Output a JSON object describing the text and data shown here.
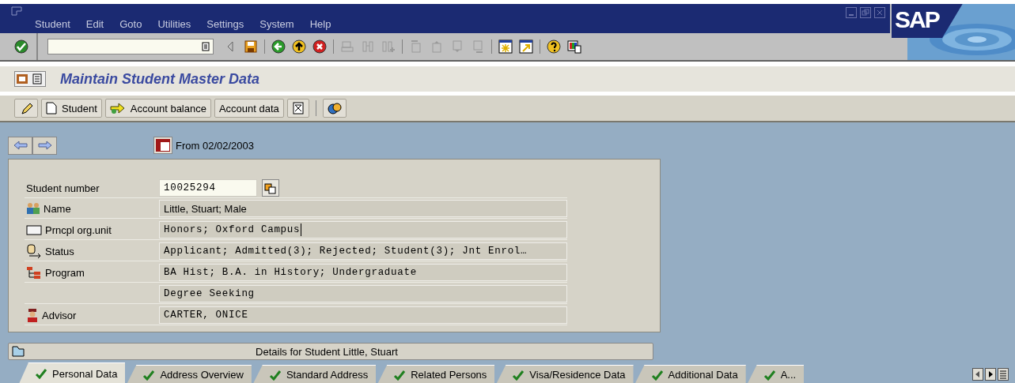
{
  "menu": [
    "Student",
    "Edit",
    "Goto",
    "Utilities",
    "Settings",
    "System",
    "Help"
  ],
  "logo": "SAP",
  "title": "Maintain Student Master Data",
  "app_toolbar": [
    "Student",
    "Account balance",
    "Account data"
  ],
  "date_label": "From 02/02/2003",
  "fields": [
    {
      "label": "Student number",
      "value": "10025294",
      "kind": "input",
      "focused": false
    },
    {
      "label": "Name",
      "value": "Little, Stuart; Male",
      "kind": "text",
      "focused": false
    },
    {
      "label": "Prncpl org.unit",
      "value": "Honors; Oxford Campus",
      "kind": "mono",
      "focused": true
    },
    {
      "label": "Status",
      "value": "Applicant; Admitted(3); Rejected; Student(3); Jnt Enrol…",
      "kind": "mono",
      "focused": false
    },
    {
      "label": "Program",
      "value": "BA Hist; B.A. in History; Undergraduate",
      "kind": "mono",
      "focused": false
    },
    {
      "value": "Degree Seeking",
      "kind": "mono",
      "focused": false
    },
    {
      "label": "Advisor",
      "value": "CARTER, ONICE",
      "kind": "mono",
      "focused": false
    }
  ],
  "details_button": "Details for Student Little, Stuart",
  "tabs": [
    {
      "label": "Personal Data",
      "selected": true
    },
    {
      "label": "Address Overview",
      "selected": false
    },
    {
      "label": "Standard Address",
      "selected": false
    },
    {
      "label": "Related Persons",
      "selected": false
    },
    {
      "label": "Visa/Residence Data",
      "selected": false
    },
    {
      "label": "Additional Data",
      "selected": false
    },
    {
      "label": "A...",
      "selected": false
    }
  ]
}
